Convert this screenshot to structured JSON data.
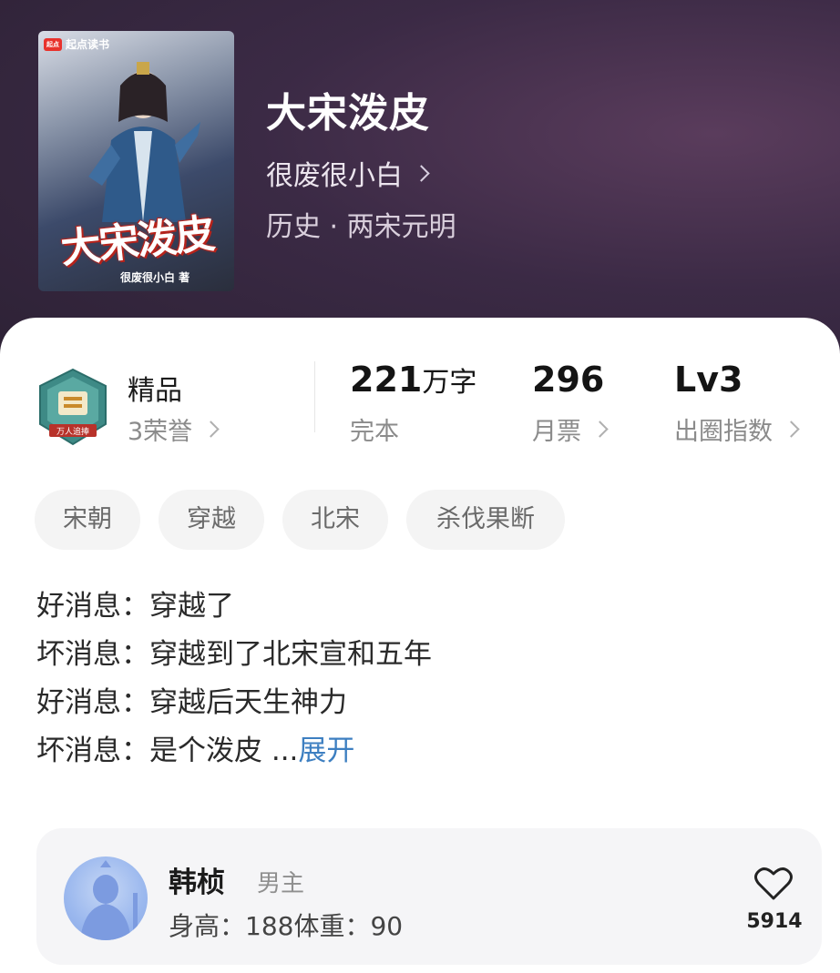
{
  "cover": {
    "badge_text": "起点读书",
    "badge_logo": "起点",
    "title_art": "大宋泼皮",
    "author_art": "很废很小白 著"
  },
  "book": {
    "title": "大宋泼皮",
    "author": "很废很小白",
    "genre": "历史 · 两宋元明"
  },
  "stats": {
    "quality": "精品",
    "honors": "3荣誉",
    "word_count": "221",
    "word_unit": "万字",
    "status": "完本",
    "monthly_tickets": "296",
    "monthly_tickets_label": "月票",
    "level": "Lv3",
    "level_label": "出圈指数",
    "badge_text": "万人追捧"
  },
  "tags": [
    "宋朝",
    "穿越",
    "北宋",
    "杀伐果断"
  ],
  "description": {
    "lines": [
      "好消息：穿越了",
      "坏消息：穿越到了北宋宣和五年",
      "好消息：穿越后天生神力",
      "坏消息：是个泼皮 ..."
    ],
    "expand_label": "展开"
  },
  "character": {
    "name": "韩桢",
    "role": "男主",
    "stats": "身高：188体重：90",
    "likes": "5914"
  },
  "colors": {
    "header_bg": "#3b2a45",
    "accent_link": "#3d7fc1",
    "tag_bg": "#f4f4f4"
  }
}
